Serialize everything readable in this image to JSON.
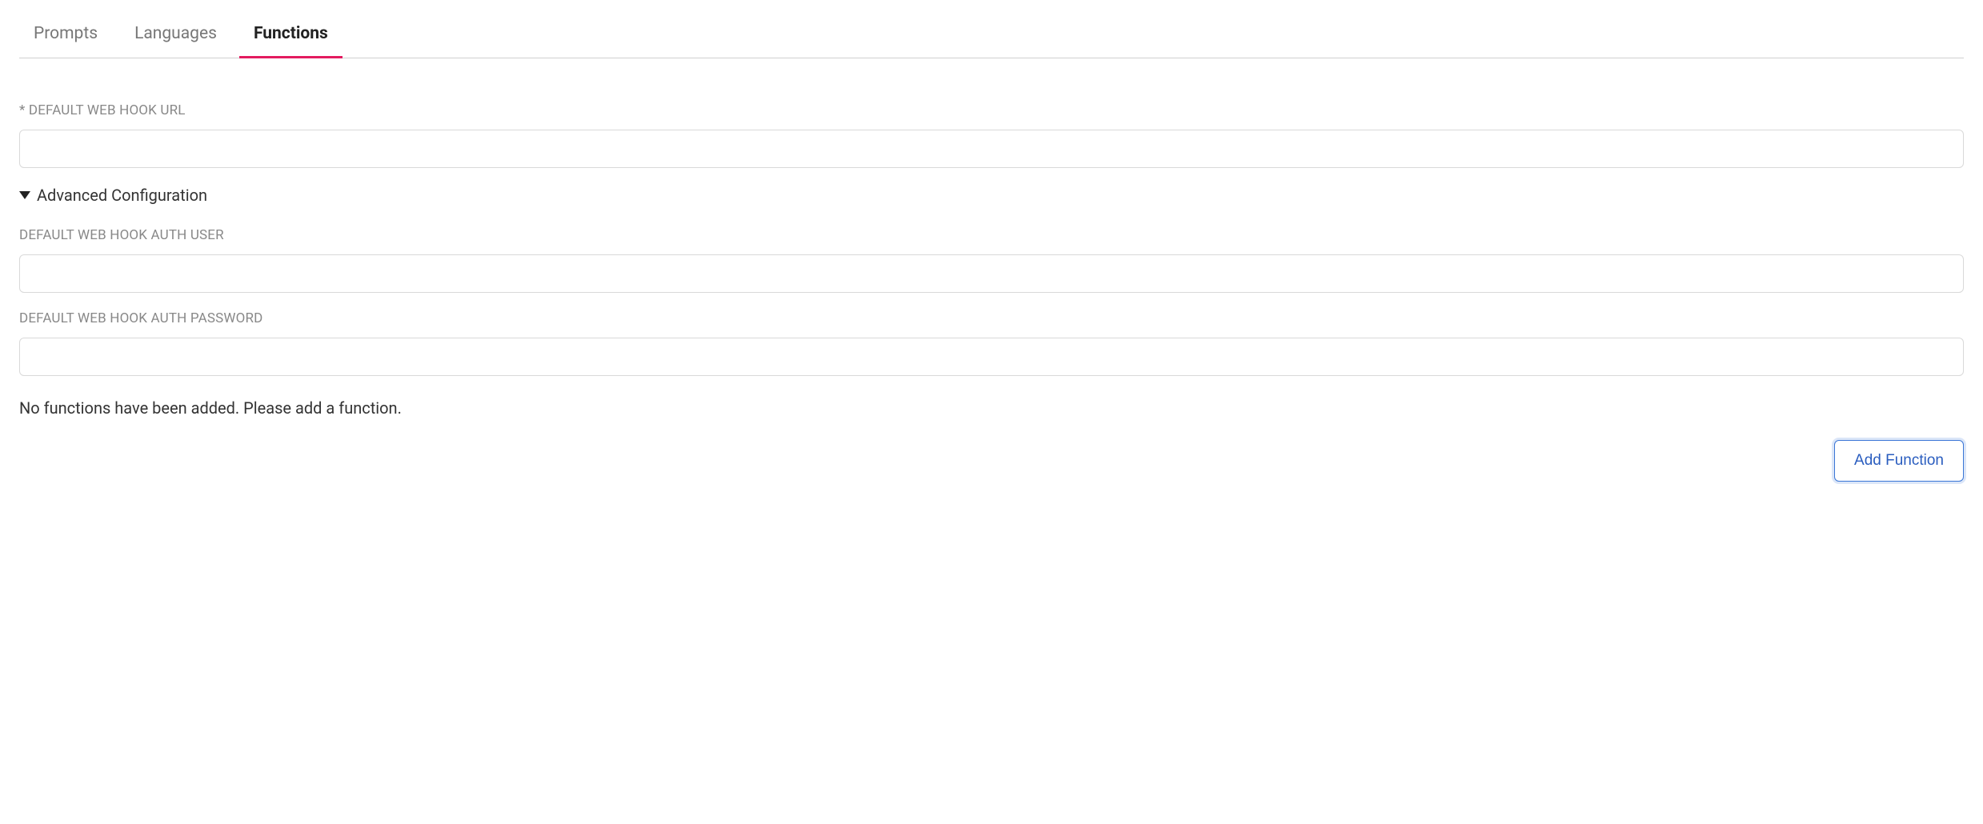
{
  "tabs": [
    {
      "label": "Prompts",
      "active": false
    },
    {
      "label": "Languages",
      "active": false
    },
    {
      "label": "Functions",
      "active": true
    }
  ],
  "fields": {
    "webhook_url": {
      "label": "* DEFAULT WEB HOOK URL",
      "value": ""
    },
    "auth_user": {
      "label": "DEFAULT WEB HOOK AUTH USER",
      "value": ""
    },
    "auth_password": {
      "label": "DEFAULT WEB HOOK AUTH PASSWORD",
      "value": ""
    }
  },
  "advanced_config_label": "Advanced Configuration",
  "empty_message": "No functions have been added. Please add a function.",
  "add_button_label": "Add Function"
}
